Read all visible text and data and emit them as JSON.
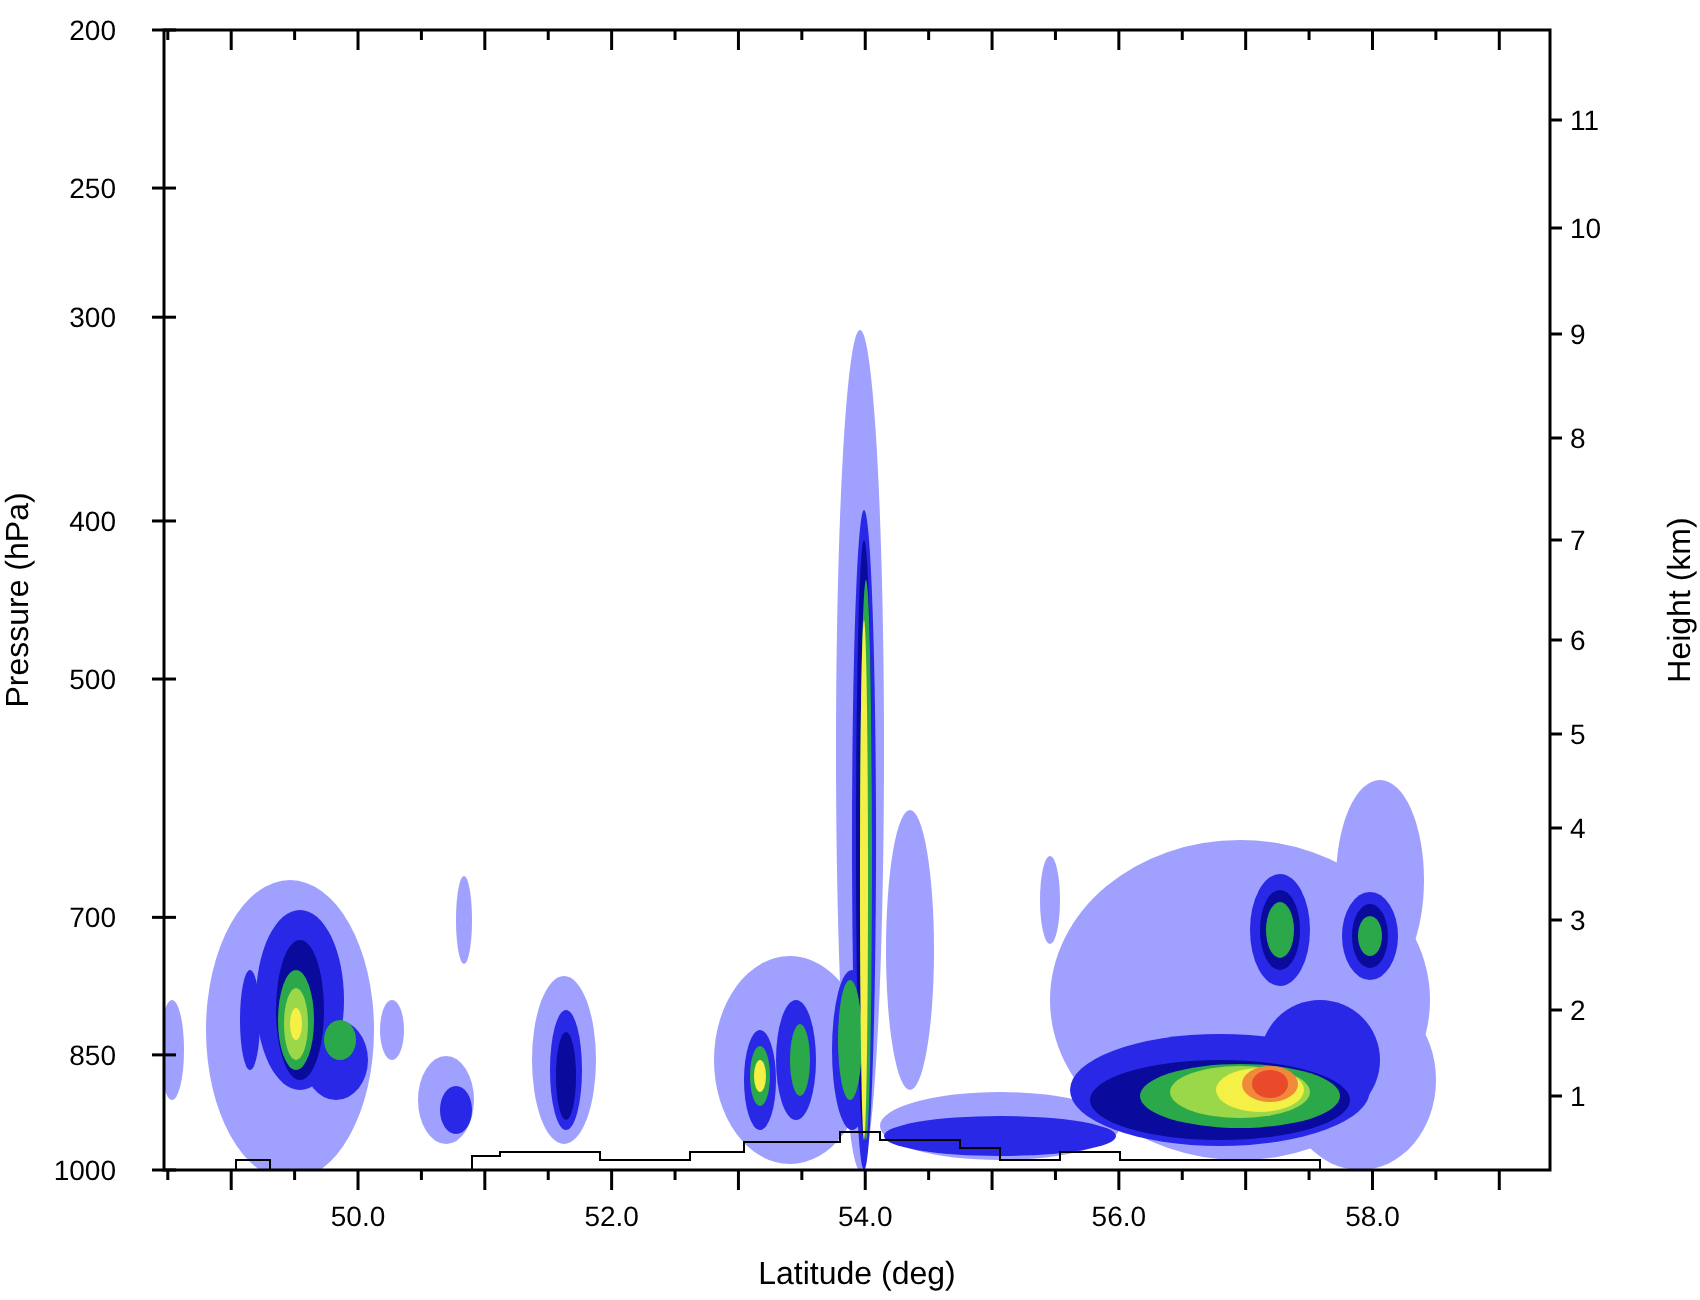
{
  "plot": {
    "xlabel": "Latitude (deg)",
    "ylabel_left": "Pressure (hPa)",
    "ylabel_right": "Height (km)",
    "pressure_ticks": [
      "200",
      "250",
      "300",
      "400",
      "500",
      "700",
      "850",
      "1000"
    ],
    "height_ticks": [
      "11",
      "10",
      "9",
      "8",
      "7",
      "6",
      "5",
      "4",
      "3",
      "2",
      "1"
    ],
    "latitude_ticks": [
      "50.0",
      "52.0",
      "54.0",
      "56.0",
      "58.0"
    ]
  }
}
